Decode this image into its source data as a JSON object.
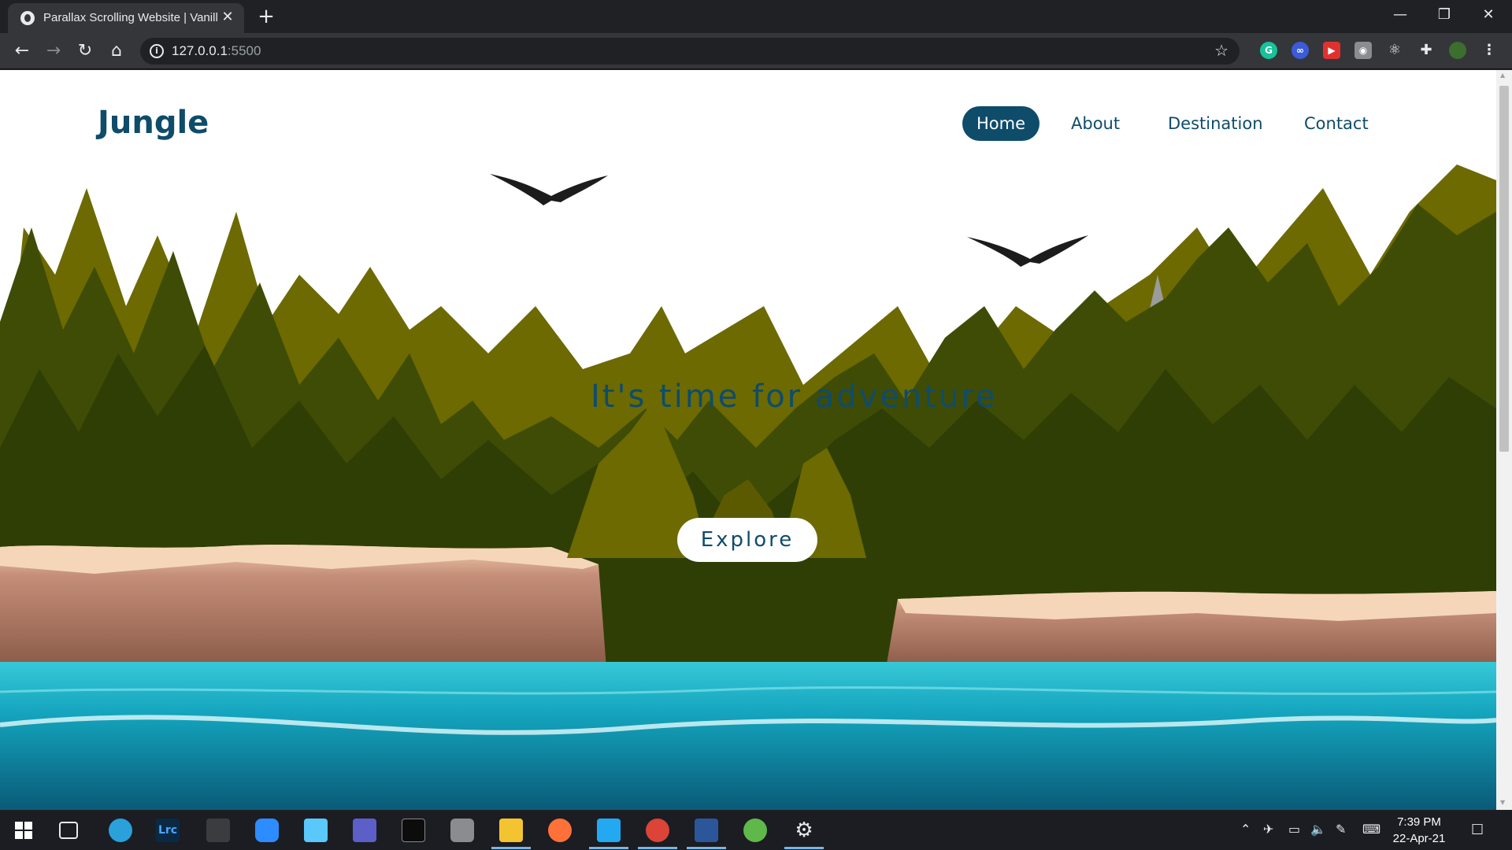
{
  "browser": {
    "tab_title": "Parallax Scrolling Website | Vanill",
    "tab_close": "✕",
    "new_tab": "+",
    "url_host": "127.0.0.1",
    "url_port": ":5500",
    "window_controls": {
      "minimize": "—",
      "restore": "❐",
      "close": "✕"
    },
    "extensions": [
      "grammarly-icon",
      "infinity-icon",
      "pdf-icon",
      "camera-icon",
      "react-icon",
      "puzzle-icon",
      "profile-avatar",
      "menu-icon"
    ]
  },
  "page": {
    "brand": "Jungle",
    "nav": [
      {
        "label": "Home",
        "active": true
      },
      {
        "label": "About",
        "active": false
      },
      {
        "label": "Destination",
        "active": false
      },
      {
        "label": "Contact",
        "active": false
      }
    ],
    "headline": "It's time for adventure",
    "explore_button": "Explore",
    "colors": {
      "primary": "#0e4c6a",
      "water": "#1aa3b8",
      "forest_light": "#6f6f00",
      "forest_dark": "#3a4a06",
      "cliff": "#c08a72"
    }
  },
  "taskbar": {
    "apps": [
      "windows-start-icon",
      "task-view-icon",
      "telegram-icon",
      "lightroom-icon",
      "app-icon",
      "zoom-icon",
      "app-square-icon",
      "teams-icon",
      "terminal-icon",
      "camera-app-icon",
      "file-explorer-icon",
      "firefox-icon",
      "vscode-icon",
      "chrome-icon",
      "word-icon",
      "utorrent-icon",
      "settings-icon"
    ],
    "lightroom_label": "Lrc",
    "time": "7:39 PM",
    "date": "22-Apr-21"
  }
}
